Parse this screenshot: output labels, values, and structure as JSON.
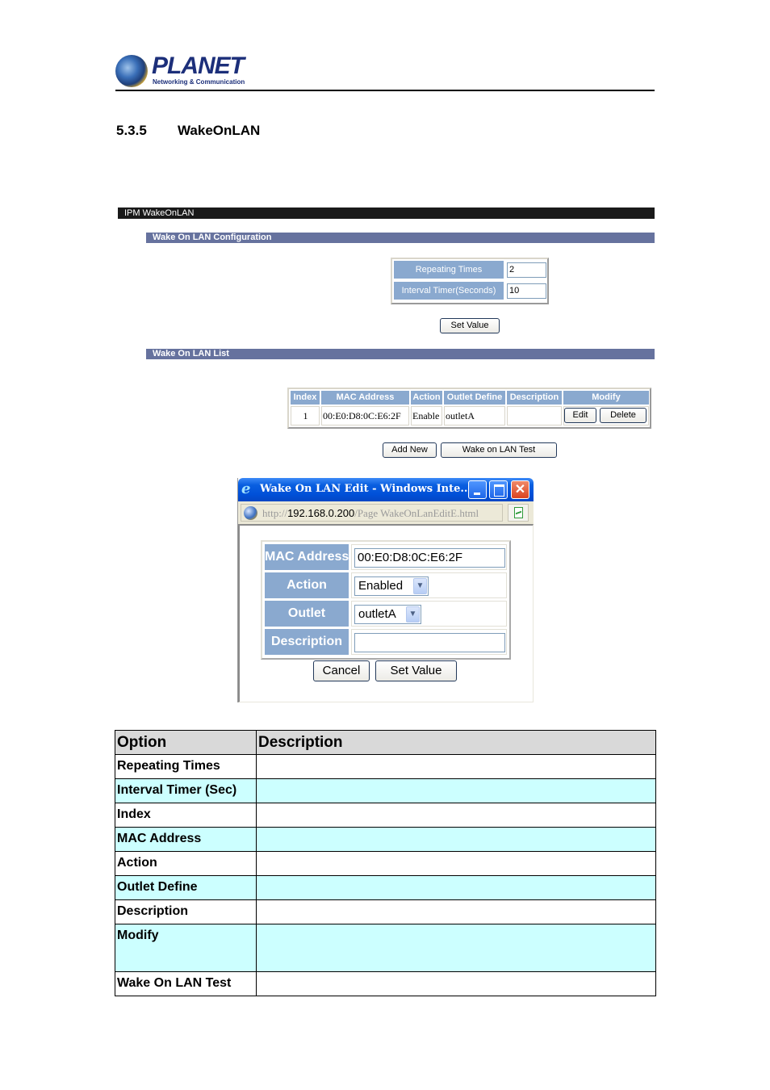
{
  "header": {
    "brand": "PLANET",
    "tagline": "Networking & Communication"
  },
  "section": {
    "number": "5.3.5",
    "title": "WakeOnLAN"
  },
  "panel": {
    "title": "IPM WakeOnLAN",
    "config": {
      "title": "Wake On LAN Configuration",
      "fields": [
        {
          "label": "Repeating Times",
          "value": "2"
        },
        {
          "label": "Interval Timer(Seconds)",
          "value": "10"
        }
      ],
      "set_value_label": "Set Value"
    },
    "list": {
      "title": "Wake On LAN List",
      "columns": [
        "Index",
        "MAC Address",
        "Action",
        "Outlet Define",
        "Description",
        "Modify"
      ],
      "rows": [
        {
          "index": "1",
          "mac": "00:E0:D8:0C:E6:2F",
          "action": "Enable",
          "outlet": "outletA",
          "description": "",
          "edit_label": "Edit",
          "delete_label": "Delete"
        }
      ],
      "add_new_label": "Add New",
      "test_label": "Wake on LAN Test"
    }
  },
  "popup": {
    "title": "Wake On LAN Edit - Windows Inte...",
    "url_prefix": "http://",
    "url_host": "192.168.0.200",
    "url_path": "/Page WakeOnLanEditE.html",
    "fields": {
      "mac_label": "MAC Address",
      "mac_value": "00:E0:D8:0C:E6:2F",
      "action_label": "Action",
      "action_value": "Enabled",
      "outlet_label": "Outlet",
      "outlet_value": "outletA",
      "description_label": "Description",
      "description_value": ""
    },
    "cancel_label": "Cancel",
    "set_value_label": "Set Value"
  },
  "options_table": {
    "headers": [
      "Option",
      "Description"
    ],
    "rows": [
      {
        "option": "Repeating Times",
        "description": ""
      },
      {
        "option": "Interval Timer (Sec)",
        "description": ""
      },
      {
        "option": "Index",
        "description": ""
      },
      {
        "option": "MAC Address",
        "description": ""
      },
      {
        "option": "Action",
        "description": ""
      },
      {
        "option": "Outlet Define",
        "description": ""
      },
      {
        "option": "Description",
        "description": ""
      },
      {
        "option": "Modify",
        "description": ""
      },
      {
        "option": "Wake On LAN Test",
        "description": ""
      }
    ]
  },
  "colors": {
    "panel_header": "#1a1a1a",
    "section_bar": "#66729e",
    "field_label_bg": "#8aa9cf",
    "table_alt_row": "#ccffff",
    "table_header": "#d9d9d9"
  }
}
